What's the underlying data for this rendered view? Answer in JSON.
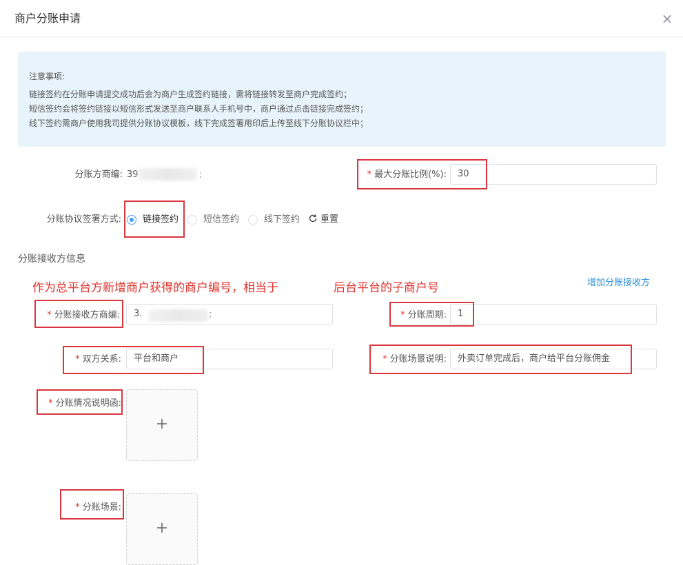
{
  "dialog": {
    "title": "商户分账申请",
    "close_symbol": "×"
  },
  "notice": {
    "heading": "注意事项:",
    "lines": [
      "链接签约在分账申请提交成功后会为商户生成签约链接，需将链接转发至商户完成签约；",
      "短信签约会将签约链接以短信形式发送至商户联系人手机号中，商户通过点击链接完成签约；",
      "线下签约需商户使用我司提供分账协议模板，线下完成签署用印后上传至线下分账协议栏中；"
    ]
  },
  "form": {
    "merchant_id_label": "分账方商编:",
    "merchant_id_prefix": "39",
    "merchant_id_suffix": ";",
    "max_ratio_label": "最大分账比例(%):",
    "max_ratio_value": "30",
    "sign_method_label": "分账协议签署方式:",
    "sign_options": [
      "链接签约",
      "短信签约",
      "线下签约"
    ],
    "sign_selected": "链接签约",
    "reset_label": "重置",
    "reset_icon": "refresh-icon"
  },
  "receiver": {
    "section_title": "分账接收方信息",
    "annotation_left": "作为总平台方新增商户获得的商户编号，相当于",
    "annotation_right": "后台平台的子商户号",
    "add_link": "增加分账接收方",
    "receiver_id_label": "分账接收方商编:",
    "receiver_id_prefix": "3.",
    "receiver_id_suffix": ";",
    "cycle_label": "分账周期:",
    "cycle_value": "1",
    "relation_label": "双方关系:",
    "relation_value": "平台和商户",
    "scene_desc_label": "分账场景说明:",
    "scene_desc_value": "外卖订单完成后，商户给平台分账佣金",
    "letter_label": "分账情况说明函:",
    "scene_label": "分账场景:",
    "upload_symbol": "+"
  },
  "colors": {
    "required": "#e0322b",
    "accent": "#409eff",
    "notice_bg": "#e8f4fb",
    "highlight_box": "#d9363e"
  }
}
